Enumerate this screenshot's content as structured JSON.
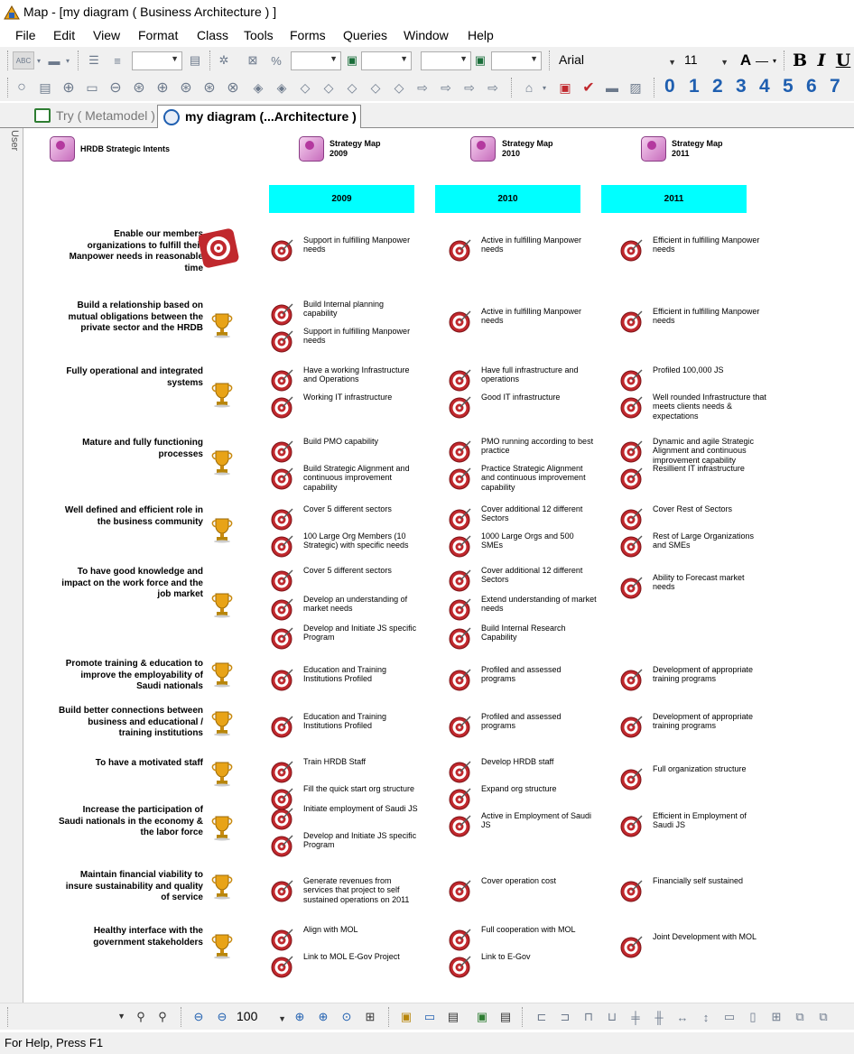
{
  "window": {
    "title": "Map - [my diagram ( Business Architecture ) ]"
  },
  "menu": [
    "File",
    "Edit",
    "View",
    "Format",
    "Class",
    "Tools",
    "Forms",
    "Queries",
    "Window",
    "Help"
  ],
  "toolbar": {
    "font_name": "Arial",
    "font_size": "11",
    "abc_label": "ABC",
    "bold": "B",
    "italic": "I",
    "underline": "U",
    "font_color": "A",
    "level_buttons": [
      "0",
      "1",
      "2",
      "3",
      "4",
      "5",
      "6",
      "7"
    ]
  },
  "tabs": [
    {
      "label": "Try ( Metamodel )",
      "active": false
    },
    {
      "label": "my diagram (...Architecture )",
      "active": true
    }
  ],
  "side_panel": {
    "label": "User"
  },
  "diagram": {
    "headers": [
      {
        "label": "HRDB Strategic Intents"
      },
      {
        "label": "Strategy Map 2009"
      },
      {
        "label": "Strategy Map 2010"
      },
      {
        "label": "Strategy Map 2011"
      }
    ],
    "years": [
      "2009",
      "2010",
      "2011"
    ],
    "rows": [
      {
        "intent": "Enable our members organizations to fulfill their Manpower  needs in reasonable time",
        "y2009": [
          "Support in fulfilling Manpower needs"
        ],
        "y2010": [
          "Active in fulfilling Manpower needs"
        ],
        "y2011": [
          "Efficient in fulfilling Manpower needs"
        ]
      },
      {
        "intent": "Build a relationship based on mutual obligations between the private sector and the HRDB",
        "y2009": [
          "Build Internal planning capability",
          "Support in fulfilling Manpower needs"
        ],
        "y2010": [
          "Active in fulfilling Manpower needs"
        ],
        "y2011": [
          "Efficient in fulfilling Manpower needs"
        ]
      },
      {
        "intent": "Fully operational and integrated systems",
        "y2009": [
          "Have a working Infrastructure and Operations",
          "Working IT infrastructure"
        ],
        "y2010": [
          "Have full infrastructure and operations",
          "Good IT infrastructure"
        ],
        "y2011": [
          "Profiled 100,000 JS",
          "Well rounded Infrastructure that meets clients needs & expectations"
        ]
      },
      {
        "intent": "Mature and fully functioning processes",
        "y2009": [
          "Build PMO capability",
          "Build Strategic Alignment and continuous improvement capability"
        ],
        "y2010": [
          "PMO running according to best practice",
          "Practice Strategic Alignment and continuous improvement capability"
        ],
        "y2011": [
          "Dynamic and agile Strategic Alignment and continuous improvement capability",
          "Resillient IT infrastructure"
        ]
      },
      {
        "intent": "Well defined and efficient role in the business community",
        "y2009": [
          "Cover 5 different sectors",
          "100 Large Org Members (10 Strategic) with specific needs"
        ],
        "y2010": [
          "Cover additional 12 different Sectors",
          "1000 Large Orgs and 500 SMEs"
        ],
        "y2011": [
          "Cover Rest of Sectors",
          "Rest of Large Organizations and SMEs"
        ]
      },
      {
        "intent": "To have good knowledge and impact on the work force and the job market",
        "y2009": [
          "Cover 5 different sectors",
          "Develop an understanding of market needs",
          "Develop and Initiate JS specific Program"
        ],
        "y2010": [
          "Cover additional 12 different Sectors",
          "Extend understanding of market needs",
          "Build Internal Research Capability"
        ],
        "y2011": [
          "Ability to Forecast market needs"
        ]
      },
      {
        "intent": "Promote training & education to improve the employability of Saudi nationals",
        "y2009": [
          "Education and Training Institutions Profiled"
        ],
        "y2010": [
          "Profiled and assessed programs"
        ],
        "y2011": [
          "Development of appropriate training programs"
        ]
      },
      {
        "intent": "Build better connections between business and educational / training institutions",
        "y2009": [
          "Education and Training Institutions Profiled"
        ],
        "y2010": [
          "Profiled and assessed programs"
        ],
        "y2011": [
          "Development of appropriate training programs"
        ]
      },
      {
        "intent": "To have a motivated staff",
        "y2009": [
          "Train HRDB Staff",
          "Fill the quick start org structure"
        ],
        "y2010": [
          "Develop HRDB staff",
          "Expand org structure"
        ],
        "y2011": [
          "Full organization structure"
        ]
      },
      {
        "intent": "Increase the participation of Saudi nationals in the economy & the labor force",
        "y2009": [
          "Initiate employment of Saudi JS",
          "Develop and Initiate JS specific Program"
        ],
        "y2010": [
          "Active in Employment of Saudi JS"
        ],
        "y2011": [
          "Efficient in Employment of Saudi JS"
        ]
      },
      {
        "intent": "Maintain financial viability to insure sustainability and quality of service",
        "y2009": [
          "Generate revenues from services that project to self sustained operations on 2011"
        ],
        "y2010": [
          "Cover operation cost"
        ],
        "y2011": [
          "Financially self sustained"
        ]
      },
      {
        "intent": "Healthy interface with the government stakeholders",
        "y2009": [
          "Align with MOL",
          "Link to MOL E-Gov Project"
        ],
        "y2010": [
          "Full cooperation with MOL",
          "Link to E-Gov"
        ],
        "y2011": [
          "Joint Development with MOL"
        ]
      }
    ]
  },
  "bottom_toolbar": {
    "zoom": "100"
  },
  "status": {
    "text": "For Help, Press F1"
  },
  "colors": {
    "year_header": "#00ffff",
    "target_red": "#c0282d",
    "trophy_gold": "#e8a317"
  }
}
